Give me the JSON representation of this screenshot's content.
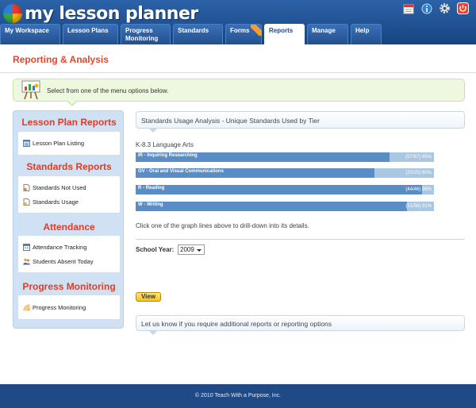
{
  "app": {
    "logo_text": "my lesson planner"
  },
  "header": {
    "icons": [
      "calendar-icon",
      "info-icon",
      "gear-icon",
      "power-icon"
    ]
  },
  "nav": {
    "tabs": [
      {
        "label": "My Workspace",
        "active": false
      },
      {
        "label": "Lesson Plans",
        "active": false
      },
      {
        "label": "Progress Monitoring",
        "active": false
      },
      {
        "label": "Standards",
        "active": false
      },
      {
        "label": "Forms",
        "active": false
      },
      {
        "label": "Reports",
        "active": true
      },
      {
        "label": "Manage",
        "active": false
      },
      {
        "label": "Help",
        "active": false
      }
    ]
  },
  "page": {
    "title": "Reporting & Analysis"
  },
  "banner": {
    "text": "Select from one of the menu options below."
  },
  "menu": {
    "sections": [
      {
        "heading": "Lesson Plan Reports",
        "items": [
          {
            "label": "Lesson Plan Listing",
            "icon": "list-icon"
          }
        ]
      },
      {
        "heading": "Standards Reports",
        "items": [
          {
            "label": "Standards Not Used",
            "icon": "document-icon"
          },
          {
            "label": "Standards Usage",
            "icon": "document-icon"
          }
        ]
      },
      {
        "heading": "Attendance",
        "items": [
          {
            "label": "Attendance Tracking",
            "icon": "calendar-icon"
          },
          {
            "label": "Students Absent Today",
            "icon": "users-icon"
          }
        ]
      },
      {
        "heading": "Progress Monitoring",
        "items": [
          {
            "label": "Progress Monitoring",
            "icon": "chart-icon"
          }
        ]
      }
    ]
  },
  "analysis": {
    "header": "Standards Usage Analysis - Unique Standards Used by Tier",
    "subject": "K-8.3 Language Arts",
    "hint": "Click one of the graph lines above to drill-down into its details.",
    "school_year_label": "School Year:",
    "school_year_value": "2009",
    "view_label": "View",
    "contact_text": "Let us know if you require additional reports or reporting options"
  },
  "chart_data": {
    "type": "bar",
    "title": "Standards Usage Analysis - Unique Standards Used by Tier",
    "subtitle": "K-8.3 Language Arts",
    "categories": [
      "IR - Inquiring Researching",
      "OV - Oral and Visual Communications",
      "R - Reading",
      "W - Writing"
    ],
    "used": [
      57,
      20,
      44,
      51
    ],
    "totals": [
      67,
      25,
      46,
      56
    ],
    "percent": [
      85,
      80,
      96,
      91
    ],
    "value_labels": [
      "(57/67) 85%",
      "(20/25) 80%",
      "(44/46) 96%",
      "(51/56) 91%"
    ],
    "xlim": [
      0,
      100
    ],
    "orientation": "horizontal"
  },
  "footer": {
    "text": "© 2010 Teach With a Purpose, Inc."
  },
  "colors": {
    "header_blue": "#1b4a88",
    "accent_red": "#e33b24",
    "bar_fill": "#5a8dc5",
    "bar_track": "#a9c6e3",
    "banner_green": "#eef8de",
    "button_yellow": "#f4c21a"
  }
}
